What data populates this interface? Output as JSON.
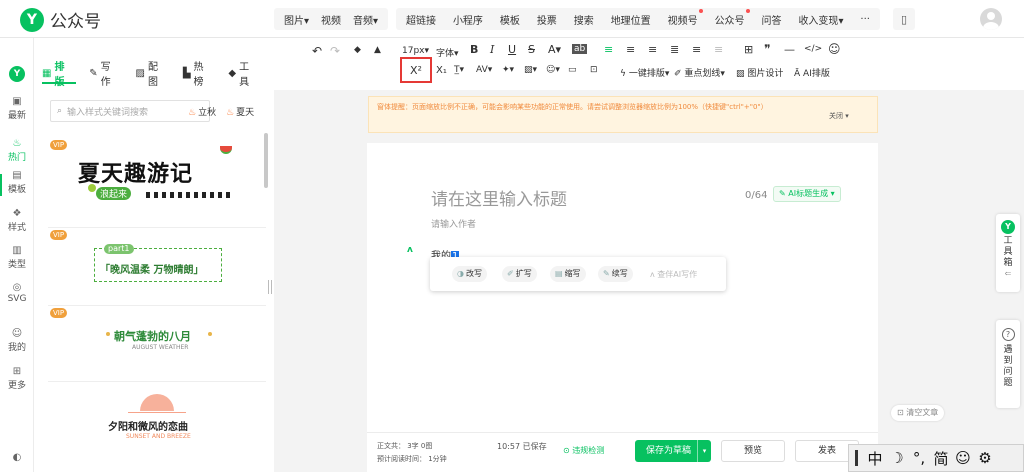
{
  "header": {
    "logo_mark": "Y",
    "app_name": "公众号",
    "nav_group1": [
      "图片",
      "视频",
      "音频"
    ],
    "nav_group2": [
      {
        "label": "超链接",
        "dot": false
      },
      {
        "label": "小程序",
        "dot": false
      },
      {
        "label": "模板",
        "dot": false
      },
      {
        "label": "投票",
        "dot": false
      },
      {
        "label": "搜索",
        "dot": false
      },
      {
        "label": "地理位置",
        "dot": false
      },
      {
        "label": "视频号",
        "dot": true
      },
      {
        "label": "公众号",
        "dot": true
      },
      {
        "label": "问答",
        "dot": false
      },
      {
        "label": "收入变现",
        "dot": false
      },
      {
        "label": "···",
        "dot": false
      }
    ],
    "doc_icon": "document-icon"
  },
  "rail": {
    "items": [
      "最新",
      "热门",
      "模板",
      "样式",
      "类型",
      "SVG",
      "我的",
      "更多"
    ],
    "active": "热门"
  },
  "panel": {
    "tabs": [
      "排版",
      "写作",
      "配图",
      "热榜",
      "工具"
    ],
    "active_tab": "排版",
    "search_placeholder": "输入样式关键词搜索",
    "hot_tags": [
      "立秋",
      "夏天"
    ],
    "cards": [
      {
        "badge": "VIP",
        "title": "夏天趣游记",
        "subtitle": "浪起来"
      },
      {
        "badge": "VIP",
        "part": "part1",
        "title": "「晚风温柔 万物晴朗」"
      },
      {
        "badge": "VIP",
        "title": "朝气蓬勃的八月",
        "subtitle": "AUGUST WEATHER"
      },
      {
        "badge": "",
        "title": "夕阳和微风的恋曲",
        "subtitle": "SUNSET AND BREEZE"
      }
    ]
  },
  "toolbar": {
    "undo": "↶",
    "redo": "↷",
    "format_brush": "◆",
    "clear_format": "▲",
    "font_size": "17px",
    "font": "字体",
    "bold": "B",
    "italic": "I",
    "underline": "U",
    "strike": "S",
    "font_color": "A",
    "bg_color": "ab",
    "align": "≡",
    "list": "≡",
    "indent": "≡",
    "table": "⊞",
    "quote": "❞",
    "dash": "—",
    "code": "</>",
    "emoji": "☺",
    "superscript": "X²",
    "subscript": "X₁",
    "one_click_layout": "一键排版",
    "key_lines": "重点划线",
    "image_design": "图片设计",
    "ai_layout": "AI排版"
  },
  "banner": {
    "text": "窗体提醒：页面缩放比例不正确，可能会影响某些功能的正常使用。请尝试调整浏览器缩放比例为100%（快捷键\"ctrl\"+\"0\"）",
    "close_label": "关闭"
  },
  "editor": {
    "title_placeholder": "请在这里输入标题",
    "title_count": "0/64",
    "ai_title_button": "AI标题生成",
    "author_placeholder": "请输入作者",
    "body_text": "我的",
    "caret_char": "1",
    "ai_actions": [
      "改写",
      "扩写",
      "缩写",
      "续写"
    ],
    "ai_write_label": "查伴AI写作"
  },
  "bottombar": {
    "stat_line1": "正文共：  3字 0图",
    "stat_line2": "预计阅读时间：  1分钟",
    "saved_time": "10:57 已保存",
    "compliance": "违规检测",
    "save_draft": "保存为草稿",
    "preview": "预览",
    "publish": "发表"
  },
  "side": {
    "clear_doc": "清空文章",
    "toolbox": "工具箱",
    "help": "遇到问题"
  },
  "ime": {
    "mode": "中",
    "moon": "☽",
    "punct": "°,",
    "simp": "简",
    "smile": "☺",
    "gear": "⚙"
  },
  "colors": {
    "brand": "#07c160",
    "warning_bg": "#fff4e0",
    "highlight_box": "#e53935"
  }
}
